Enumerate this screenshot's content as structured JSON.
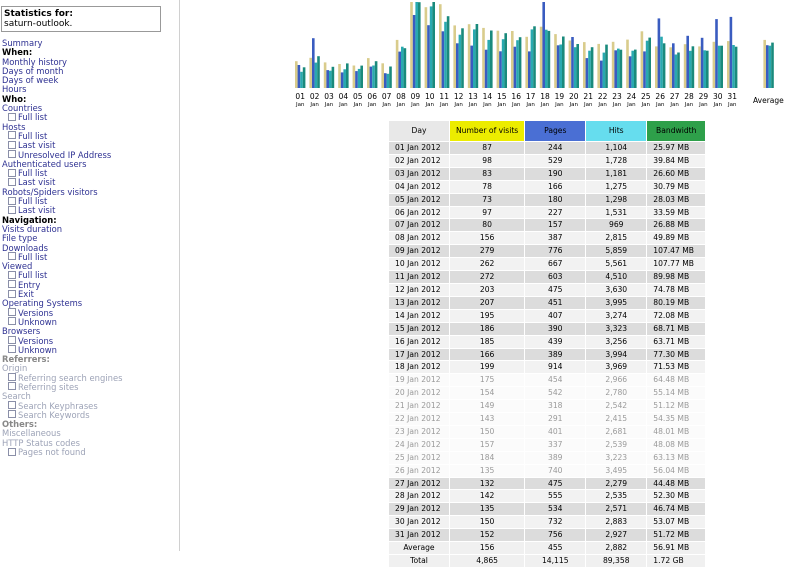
{
  "stats": {
    "title": "Statistics for:",
    "site": "saturn-outlook."
  },
  "menu": [
    {
      "text": "Summary",
      "kind": "link"
    },
    {
      "text": "When:",
      "kind": "head"
    },
    {
      "text": "Monthly history",
      "kind": "link"
    },
    {
      "text": "Days of month",
      "kind": "link"
    },
    {
      "text": "Days of week",
      "kind": "link"
    },
    {
      "text": "Hours",
      "kind": "link"
    },
    {
      "text": "Who:",
      "kind": "head"
    },
    {
      "text": "Countries",
      "kind": "link"
    },
    {
      "text": "Full list",
      "kind": "sub"
    },
    {
      "text": "Hosts",
      "kind": "link"
    },
    {
      "text": "Full list",
      "kind": "sub"
    },
    {
      "text": "Last visit",
      "kind": "sub"
    },
    {
      "text": "Unresolved IP Address",
      "kind": "sub"
    },
    {
      "text": "Authenticated users",
      "kind": "link"
    },
    {
      "text": "Full list",
      "kind": "sub"
    },
    {
      "text": "Last visit",
      "kind": "sub"
    },
    {
      "text": "Robots/Spiders visitors",
      "kind": "link"
    },
    {
      "text": "Full list",
      "kind": "sub"
    },
    {
      "text": "Last visit",
      "kind": "sub"
    },
    {
      "text": "Navigation:",
      "kind": "head"
    },
    {
      "text": "Visits duration",
      "kind": "link"
    },
    {
      "text": "File type",
      "kind": "link"
    },
    {
      "text": "Downloads",
      "kind": "link"
    },
    {
      "text": "Full list",
      "kind": "sub"
    },
    {
      "text": "Viewed",
      "kind": "link"
    },
    {
      "text": "Full list",
      "kind": "sub"
    },
    {
      "text": "Entry",
      "kind": "sub"
    },
    {
      "text": "Exit",
      "kind": "sub"
    },
    {
      "text": "Operating Systems",
      "kind": "link"
    },
    {
      "text": "Versions",
      "kind": "sub"
    },
    {
      "text": "Unknown",
      "kind": "sub"
    },
    {
      "text": "Browsers",
      "kind": "link"
    },
    {
      "text": "Versions",
      "kind": "sub"
    },
    {
      "text": "Unknown",
      "kind": "sub"
    },
    {
      "text": "Referrers:",
      "kind": "headdim"
    },
    {
      "text": "Origin",
      "kind": "dim"
    },
    {
      "text": "Referring search engines",
      "kind": "subdim"
    },
    {
      "text": "Referring sites",
      "kind": "subdim"
    },
    {
      "text": "Search",
      "kind": "dim"
    },
    {
      "text": "Search Keyphrases",
      "kind": "subdim"
    },
    {
      "text": "Search Keywords",
      "kind": "subdim"
    },
    {
      "text": "Others:",
      "kind": "headdim"
    },
    {
      "text": "Miscellaneous",
      "kind": "dim"
    },
    {
      "text": "HTTP Status codes",
      "kind": "dim"
    },
    {
      "text": "Pages not found",
      "kind": "subdim"
    }
  ],
  "table": {
    "headers": {
      "day": "Day",
      "visits": "Number of visits",
      "pages": "Pages",
      "hits": "Hits",
      "bandwidth": "Bandwidth"
    },
    "header_colors": {
      "visits": "#ecec00",
      "pages": "#4a6fd4",
      "hits": "#66ddee",
      "bandwidth": "#2ea04a",
      "day": "#e8e8e8"
    },
    "rows": [
      {
        "day": "01 Jan 2012",
        "visits": "87",
        "pages": "244",
        "hits": "1,104",
        "bw": "25.97 MB",
        "fade": false
      },
      {
        "day": "02 Jan 2012",
        "visits": "98",
        "pages": "529",
        "hits": "1,728",
        "bw": "39.84 MB",
        "fade": false
      },
      {
        "day": "03 Jan 2012",
        "visits": "83",
        "pages": "190",
        "hits": "1,181",
        "bw": "26.60 MB",
        "fade": false
      },
      {
        "day": "04 Jan 2012",
        "visits": "78",
        "pages": "166",
        "hits": "1,275",
        "bw": "30.79 MB",
        "fade": false
      },
      {
        "day": "05 Jan 2012",
        "visits": "73",
        "pages": "180",
        "hits": "1,298",
        "bw": "28.03 MB",
        "fade": false
      },
      {
        "day": "06 Jan 2012",
        "visits": "97",
        "pages": "227",
        "hits": "1,531",
        "bw": "33.59 MB",
        "fade": false
      },
      {
        "day": "07 Jan 2012",
        "visits": "80",
        "pages": "157",
        "hits": "969",
        "bw": "26.88 MB",
        "fade": false
      },
      {
        "day": "08 Jan 2012",
        "visits": "156",
        "pages": "387",
        "hits": "2,815",
        "bw": "49.89 MB",
        "fade": false
      },
      {
        "day": "09 Jan 2012",
        "visits": "279",
        "pages": "776",
        "hits": "5,859",
        "bw": "107.47 MB",
        "fade": false
      },
      {
        "day": "10 Jan 2012",
        "visits": "262",
        "pages": "667",
        "hits": "5,561",
        "bw": "107.77 MB",
        "fade": false
      },
      {
        "day": "11 Jan 2012",
        "visits": "272",
        "pages": "603",
        "hits": "4,510",
        "bw": "89.98 MB",
        "fade": false
      },
      {
        "day": "12 Jan 2012",
        "visits": "203",
        "pages": "475",
        "hits": "3,630",
        "bw": "74.78 MB",
        "fade": false
      },
      {
        "day": "13 Jan 2012",
        "visits": "207",
        "pages": "451",
        "hits": "3,995",
        "bw": "80.19 MB",
        "fade": false
      },
      {
        "day": "14 Jan 2012",
        "visits": "195",
        "pages": "407",
        "hits": "3,274",
        "bw": "72.08 MB",
        "fade": false
      },
      {
        "day": "15 Jan 2012",
        "visits": "186",
        "pages": "390",
        "hits": "3,323",
        "bw": "68.71 MB",
        "fade": false
      },
      {
        "day": "16 Jan 2012",
        "visits": "185",
        "pages": "439",
        "hits": "3,256",
        "bw": "63.71 MB",
        "fade": false
      },
      {
        "day": "17 Jan 2012",
        "visits": "166",
        "pages": "389",
        "hits": "3,994",
        "bw": "77.30 MB",
        "fade": false
      },
      {
        "day": "18 Jan 2012",
        "visits": "199",
        "pages": "914",
        "hits": "3,969",
        "bw": "71.53 MB",
        "fade": false
      },
      {
        "day": "19 Jan 2012",
        "visits": "175",
        "pages": "454",
        "hits": "2,966",
        "bw": "64.48 MB",
        "fade": true
      },
      {
        "day": "20 Jan 2012",
        "visits": "154",
        "pages": "542",
        "hits": "2,780",
        "bw": "55.14 MB",
        "fade": true
      },
      {
        "day": "21 Jan 2012",
        "visits": "149",
        "pages": "318",
        "hits": "2,542",
        "bw": "51.12 MB",
        "fade": true
      },
      {
        "day": "22 Jan 2012",
        "visits": "143",
        "pages": "291",
        "hits": "2,415",
        "bw": "54.35 MB",
        "fade": true
      },
      {
        "day": "23 Jan 2012",
        "visits": "150",
        "pages": "401",
        "hits": "2,681",
        "bw": "48.01 MB",
        "fade": true
      },
      {
        "day": "24 Jan 2012",
        "visits": "157",
        "pages": "337",
        "hits": "2,539",
        "bw": "48.08 MB",
        "fade": true
      },
      {
        "day": "25 Jan 2012",
        "visits": "184",
        "pages": "389",
        "hits": "3,223",
        "bw": "63.13 MB",
        "fade": true
      },
      {
        "day": "26 Jan 2012",
        "visits": "135",
        "pages": "740",
        "hits": "3,495",
        "bw": "56.04 MB",
        "fade": true
      },
      {
        "day": "27 Jan 2012",
        "visits": "132",
        "pages": "475",
        "hits": "2,279",
        "bw": "44.48 MB",
        "fade": false
      },
      {
        "day": "28 Jan 2012",
        "visits": "142",
        "pages": "555",
        "hits": "2,535",
        "bw": "52.30 MB",
        "fade": false
      },
      {
        "day": "29 Jan 2012",
        "visits": "135",
        "pages": "534",
        "hits": "2,571",
        "bw": "46.74 MB",
        "fade": false
      },
      {
        "day": "30 Jan 2012",
        "visits": "150",
        "pages": "732",
        "hits": "2,883",
        "bw": "53.07 MB",
        "fade": false
      },
      {
        "day": "31 Jan 2012",
        "visits": "152",
        "pages": "756",
        "hits": "2,927",
        "bw": "51.72 MB",
        "fade": false
      }
    ],
    "average": {
      "label": "Average",
      "visits": "156",
      "pages": "455",
      "hits": "2,882",
      "bw": "56.91 MB"
    },
    "total": {
      "label": "Total",
      "visits": "4,865",
      "pages": "14,115",
      "hits": "89,358",
      "bw": "1.72 GB"
    }
  },
  "chart_data": {
    "type": "bar",
    "categories": [
      "01",
      "02",
      "03",
      "04",
      "05",
      "06",
      "07",
      "08",
      "09",
      "10",
      "11",
      "12",
      "13",
      "14",
      "15",
      "16",
      "17",
      "18",
      "19",
      "20",
      "21",
      "22",
      "23",
      "24",
      "25",
      "26",
      "27",
      "28",
      "29",
      "30",
      "31"
    ],
    "sublabel": "Jan",
    "average_label": "Average",
    "series": [
      {
        "color": "#d9cc8c",
        "values": [
          87,
          98,
          83,
          78,
          73,
          97,
          80,
          156,
          279,
          262,
          272,
          203,
          207,
          195,
          186,
          185,
          166,
          199,
          175,
          154,
          149,
          143,
          150,
          157,
          184,
          135,
          132,
          142,
          135,
          150,
          152
        ],
        "avg": 156
      },
      {
        "color": "#3a5cc0",
        "values": [
          244,
          529,
          190,
          166,
          180,
          227,
          157,
          387,
          776,
          667,
          603,
          475,
          451,
          407,
          390,
          439,
          389,
          914,
          454,
          542,
          318,
          291,
          401,
          337,
          389,
          740,
          475,
          555,
          534,
          732,
          756
        ],
        "avg": 455
      },
      {
        "color": "#29a9b0",
        "values": [
          1104,
          1728,
          1181,
          1275,
          1298,
          1531,
          969,
          2815,
          5859,
          5561,
          4510,
          3630,
          3995,
          3274,
          3323,
          3256,
          3994,
          3969,
          2966,
          2780,
          2542,
          2415,
          2681,
          2539,
          3223,
          3495,
          2279,
          2535,
          2571,
          2883,
          2927
        ],
        "avg": 2882
      },
      {
        "color": "#1a8a7c",
        "values": [
          25.97,
          39.84,
          26.6,
          30.79,
          28.03,
          33.59,
          26.88,
          49.89,
          107.47,
          107.77,
          89.98,
          74.78,
          80.19,
          72.08,
          68.71,
          63.71,
          77.3,
          71.53,
          64.48,
          55.14,
          51.12,
          54.35,
          48.01,
          48.08,
          63.13,
          56.04,
          44.48,
          52.3,
          46.74,
          53.07,
          51.72
        ],
        "avg": 56.91
      }
    ]
  }
}
